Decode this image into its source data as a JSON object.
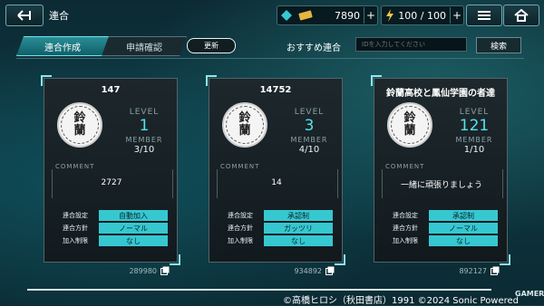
{
  "header": {
    "title": "連合",
    "gems": "7890",
    "energy": "100 / 100"
  },
  "tabs": [
    {
      "label": "連合作成"
    },
    {
      "label": "申請確認"
    }
  ],
  "refresh_label": "更新",
  "recommend_label": "おすすめ連合",
  "search": {
    "placeholder": "IDを入力してください",
    "button": "検索"
  },
  "card_labels": {
    "level": "LEVEL",
    "member": "MEMBER",
    "comment": "COMMENT",
    "setting": "連合設定",
    "policy": "連合方針",
    "restriction": "加入制限"
  },
  "emblem_text": [
    "鈴",
    "蘭"
  ],
  "cards": [
    {
      "name": "147",
      "level": "1",
      "members": "3/10",
      "comment": "2727",
      "setting": "自動加入",
      "policy": "ノーマル",
      "restriction": "なし",
      "id": "289980"
    },
    {
      "name": "14752",
      "level": "3",
      "members": "4/10",
      "comment": "14",
      "setting": "承認制",
      "policy": "ガッツリ",
      "restriction": "なし",
      "id": "934892"
    },
    {
      "name": "鈴蘭高校と鳳仙学園の者達",
      "level": "121",
      "members": "1/10",
      "comment": "一緒に頑張りましょう",
      "setting": "承認制",
      "policy": "ノーマル",
      "restriction": "なし",
      "id": "892127"
    }
  ],
  "footer": {
    "copyright": "©高橋ヒロシ（秋田書店）1991 ©2024 Sonic Powered",
    "watermark": "GAMER"
  },
  "colors": {
    "accent": "#36c8d1",
    "level": "#55e2ec",
    "background": "#0e3640"
  }
}
